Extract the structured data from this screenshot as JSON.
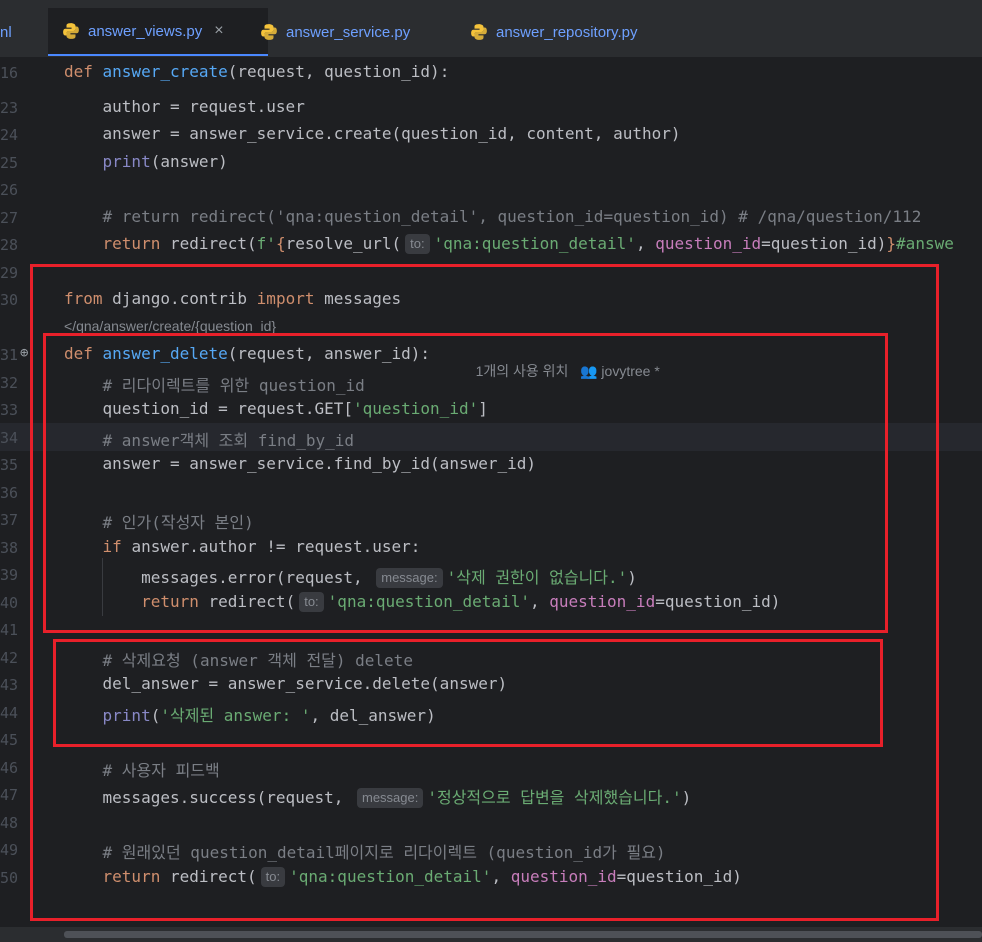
{
  "tabs": [
    {
      "label": "nl"
    },
    {
      "label": "answer_views.py",
      "active": true
    },
    {
      "label": "answer_service.py"
    },
    {
      "label": "answer_repository.py"
    }
  ],
  "lines": [
    {
      "n": "16",
      "code": "<span class='kw'>def </span><span class='fn'>answer_create</span>(request, question_id):"
    },
    {
      "n": "23",
      "code": "    author = request.user"
    },
    {
      "n": "24",
      "code": "    answer = answer_service.create(question_id, content, author)"
    },
    {
      "n": "25",
      "code": "    <span class='bi'>print</span>(answer)"
    },
    {
      "n": "26",
      "code": ""
    },
    {
      "n": "27",
      "code": "    <span class='cm'># return redirect('qna:question_detail', question_id=question_id) # /qna/question/112</span>"
    },
    {
      "n": "28",
      "code": "    <span class='kw'>return </span>redirect(<span class='str'>f'</span><span class='kw'>{</span>resolve_url(<span class='hint'>to:</span><span class='str'>'qna:question_detail'</span>, <span class='pm'>question_id</span>=question_id)<span class='kw'>}</span><span class='str'>#answe</span>"
    },
    {
      "n": "29",
      "code": ""
    },
    {
      "n": "30",
      "code": "<span class='kw'>from </span>django.contrib <span class='kw'>import </span>messages"
    },
    {
      "n": "31",
      "code": "<span class='kw'>def </span><span class='fn'>answer_delete</span>(request, answer_id):"
    },
    {
      "n": "32",
      "code": "    <span class='cm'># 리다이렉트를 위한 question_id</span>"
    },
    {
      "n": "33",
      "code": "    question_id = request.GET[<span class='str'>'question_id'</span>]"
    },
    {
      "n": "34",
      "code": "    <span class='cm'># answer객체 조회 find_by_id</span>"
    },
    {
      "n": "35",
      "code": "    answer = answer_service.find_by_id(answer_id)"
    },
    {
      "n": "36",
      "code": ""
    },
    {
      "n": "37",
      "code": "    <span class='cm'># 인가(작성자 본인)</span>"
    },
    {
      "n": "38",
      "code": "    <span class='kw'>if </span>answer.author != request.user:"
    },
    {
      "n": "39",
      "code": "        messages.error(request, <span class='hint'>message:</span><span class='str'>'삭제 권한이 없습니다.'</span>)"
    },
    {
      "n": "40",
      "code": "        <span class='kw'>return </span>redirect(<span class='hint'>to:</span><span class='str'>'qna:question_detail'</span>, <span class='pm'>question_id</span>=question_id)"
    },
    {
      "n": "41",
      "code": ""
    },
    {
      "n": "42",
      "code": "    <span class='cm'># 삭제요청 (answer 객체 전달) delete</span>"
    },
    {
      "n": "43",
      "code": "    del_answer = answer_service.delete(answer)"
    },
    {
      "n": "44",
      "code": "    <span class='bi'>print</span>(<span class='str'>'삭제된 answer: '</span>, del_answer)"
    },
    {
      "n": "45",
      "code": ""
    },
    {
      "n": "46",
      "code": "    <span class='cm'># 사용자 피드백</span>"
    },
    {
      "n": "47",
      "code": "    messages.success(request, <span class='hint'>message:</span><span class='str'>'정상적으로 답변을 삭제했습니다.'</span>)"
    },
    {
      "n": "48",
      "code": ""
    },
    {
      "n": "49",
      "code": "    <span class='cm'># 원래있던 question_detail페이지로 리다이렉트 (question_id가 필요)</span>"
    },
    {
      "n": "50",
      "code": "    <span class='kw'>return </span>redirect(<span class='hint'>to:</span><span class='str'>'qna:question_detail'</span>, <span class='pm'>question_id</span>=question_id)"
    }
  ],
  "route_hint": "/qna/answer/create/{question_id}",
  "usages_text": "1개의 사용 위치",
  "author_text": "jovytree *",
  "colors": {
    "red_box": "#e8202a",
    "accent": "#4a88ff"
  }
}
